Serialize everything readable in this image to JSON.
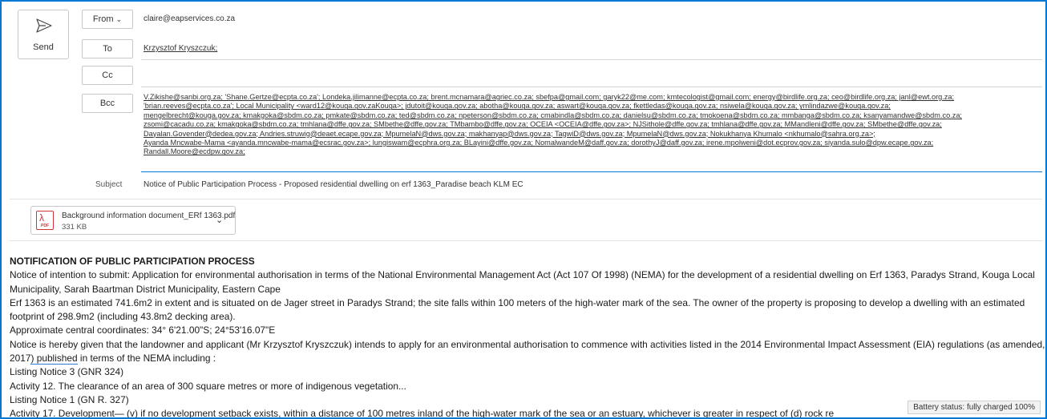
{
  "send": {
    "label": "Send"
  },
  "from": {
    "label": "From",
    "value": "claire@eapservices.co.za"
  },
  "to": {
    "label": "To",
    "value": "Krzysztof Kryszczuk;"
  },
  "cc": {
    "label": "Cc",
    "value": ""
  },
  "bcc": {
    "label": "Bcc",
    "lines": [
      "V.Zikishe@sanbi.org.za; 'Shane.Gertze@ecpta.co.za'; Londeka.jilimanne@ecpta.co.za; brent.mcnamara@agriec.co.za; sbefpa@gmail.com; garyk22@me.com; kmtecologist@gmail.com; energy@birdlife.org.za; ceo@birdlife.org.za; janl@ewt.org.za;",
      "'brian.reeves@ecpta.co.za'; Local Municipality <ward12@kouga.gov.zaKouga>; jdutoit@kouga.gov.za; abotha@kouga.gov.za; aswart@kouga.gov.za; fkettledas@kouga.gov.za; nsiwela@kouga.gov.za; ymlindazwe@kouga.gov.za;",
      "mengelbrecht@kouga.gov.za; kmakgoka@sbdm.co.za; pmkate@sbdm.co.za; ted@sbdm.co.za; npeterson@sbdm.co.za; cmabindla@sbdm.co.za; danielsu@sbdm.co.za; tmokoena@sbdm.co.za; mmbanga@sbdm.co.za; ksanyamandwe@sbdm.co.za;",
      "zsomi@cacadu.co.za; kmakgoka@sbdm.co.za; tmhlana@dffe.gov.za; SMbethe@dffe.gov.za; TMbambo@dffe.gov.za; OCEIA <OCEIA@dffe.gov.za>; NJSithole@dffe.gov.za; tmhlana@dffe.gov.za; MMandleni@dffe.gov.za; SMbethe@dffe.gov.za;",
      "Dayalan.Govender@dedea.gov.za; Andries.struwig@deaet.ecape.gov.za; MpumelaN@dws.gov.za; makhanyap@dws.gov.za; TagwiD@dws.gov.za; MpumelaN@dws.gov.za; Nokukhanya Khumalo <nkhumalo@sahra.org.za>;",
      "Ayanda Mncwabe-Mama <ayanda.mncwabe-mama@ecsrac.gov.za>; lungiswam@ecphra.org.za; BLayini@dffe.gov.za; NomalwandeM@daff.gov.za; dorothyJ@daff.gov.za; irene.mpolweni@dot.ecprov.gov.za; siyanda.sulo@dpw.ecape.gov.za;",
      "Randall.Moore@ecdpw.gov.za;"
    ]
  },
  "subject": {
    "label": "Subject",
    "value": "Notice of Public Participation Process - Proposed residential dwelling on erf 1363_Paradise beach KLM EC"
  },
  "attachment": {
    "name": "Background information document_ERf 1363.pdf",
    "size": "331 KB",
    "icon": "pdf-icon",
    "icon_tag": "PDF"
  },
  "body": {
    "heading": "NOTIFICATION OF PUBLIC PARTICIPATION PROCESS",
    "p1": "Notice of intention to submit: Application for environmental authorisation in terms of the National Environmental Management Act (Act 107 Of 1998) (NEMA) for the development of a residential dwelling on Erf 1363, Paradys Strand, Kouga Local Municipality, Sarah Baartman District Municipality, Eastern Cape",
    "p2": "Erf 1363 is an estimated 741.6m2 in extent and is situated on de Jager street in Paradys Strand; the site falls within 100 meters of the high-water mark of the sea. The owner of the property is proposing to develop a dwelling with an estimated footprint of 298.9m2 (including 43.8m2 decking area).",
    "p3": "Approximate central coordinates: 34° 6'21.00\"S; 24°53'16.07\"E",
    "p4a": "Notice is hereby given that the landowner and applicant (Mr Krzysztof Kryszczuk) intends to apply for an environmental authorisation to commence with activities listed in the 2014 Environmental Impact Assessment (EIA) regulations (as amended, 2017",
    "p4b": ") published",
    "p4c": " in terms of the NEMA including :",
    "p5": "Listing Notice 3 (GNR 324)",
    "p6": "Activity 12. The clearance of an area of 300 square metres or more of indigenous vegetation...",
    "p7": "Listing Notice 1 (GN R. 327)",
    "p8": "Activity 17. Development— (v) if no development setback exists, within a distance of 100 metres inland of the high-water mark of the sea or an estuary, whichever is greater in respect of (d) rock re"
  },
  "status": {
    "battery": "Battery status: fully charged 100%"
  },
  "colors": {
    "accent": "#0078d4",
    "pdf": "#d13438"
  }
}
